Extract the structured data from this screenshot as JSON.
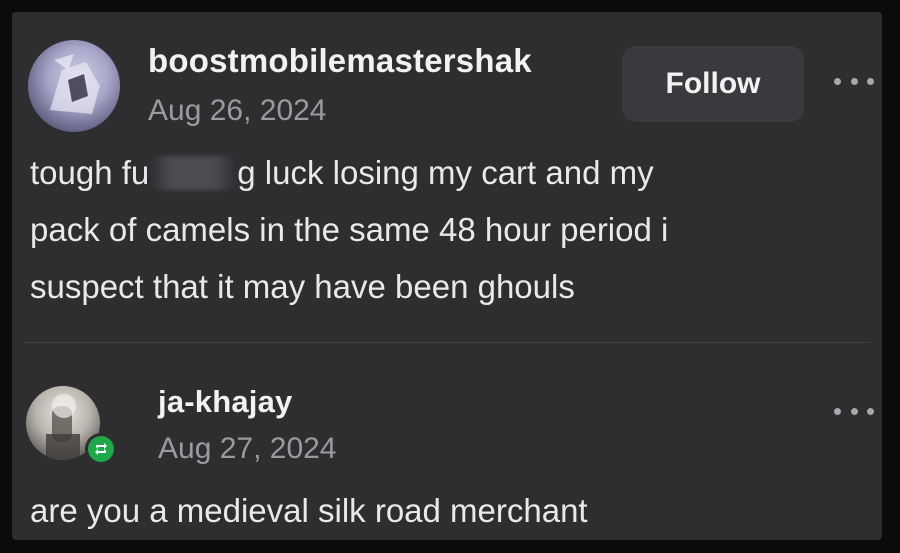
{
  "post": {
    "username": "boostmobilemastershak",
    "date": "Aug 26, 2024",
    "follow_label": "Follow",
    "body": {
      "line1_start": "tough fu",
      "line1_end": "g luck losing my cart and my",
      "line2": "pack of camels in the same 48 hour period i",
      "line3": "suspect that it may have been ghouls"
    },
    "avatar_icon": "user-avatar",
    "more_icon": "more-options-icon"
  },
  "reblog": {
    "username": "ja-khajay",
    "date": "Aug 27, 2024",
    "body": "are you a medieval silk road merchant",
    "badge_icon": "reblog-icon",
    "badge_color": "#1fa84a",
    "more_icon": "more-options-icon"
  },
  "theme": {
    "background": "#2e2e31",
    "text": "#e9e9ec",
    "muted": "#9a9a9f"
  }
}
